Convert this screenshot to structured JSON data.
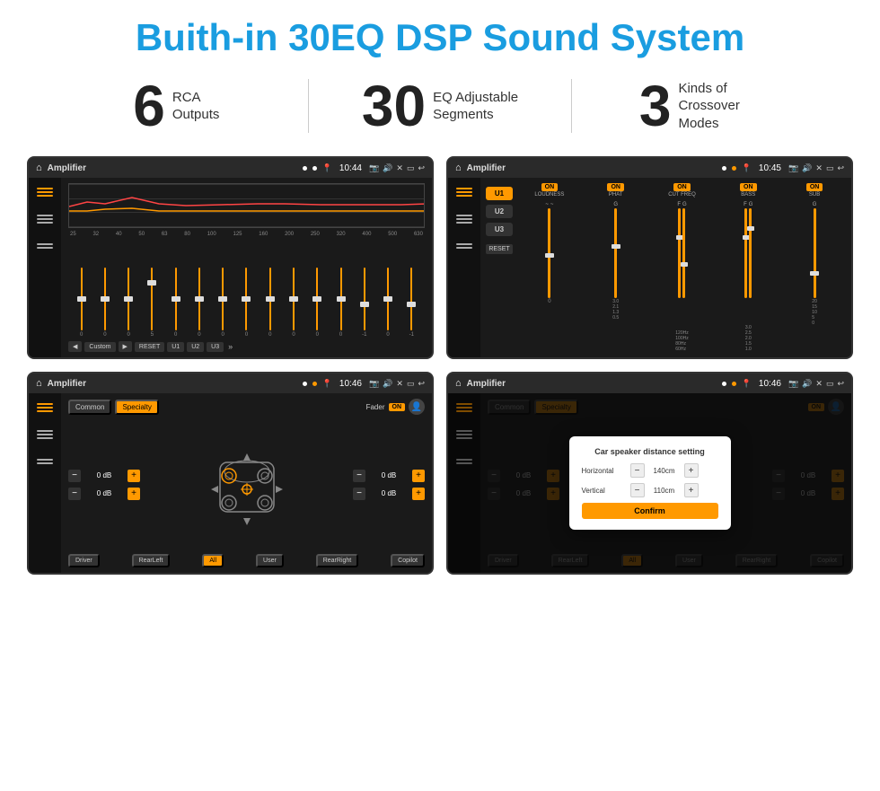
{
  "header": {
    "title": "Buith-in 30EQ DSP Sound System"
  },
  "stats": [
    {
      "number": "6",
      "label": "RCA\nOutputs"
    },
    {
      "number": "30",
      "label": "EQ Adjustable\nSegments"
    },
    {
      "number": "3",
      "label": "Kinds of\nCrossover Modes"
    }
  ],
  "screens": {
    "eq": {
      "title": "Amplifier",
      "time": "10:44",
      "freqs": [
        "25",
        "32",
        "40",
        "50",
        "63",
        "80",
        "100",
        "125",
        "160",
        "200",
        "250",
        "320",
        "400",
        "500",
        "630"
      ],
      "values": [
        "0",
        "0",
        "0",
        "5",
        "0",
        "0",
        "0",
        "0",
        "0",
        "0",
        "0",
        "0",
        "-1",
        "0",
        "-1"
      ],
      "buttons": [
        "Custom",
        "RESET",
        "U1",
        "U2",
        "U3"
      ]
    },
    "presets": {
      "title": "Amplifier",
      "time": "10:45",
      "presets": [
        "U1",
        "U2",
        "U3"
      ],
      "controls": [
        "LOUDNESS",
        "PHAT",
        "CUT FREQ",
        "BASS",
        "SUB"
      ],
      "toggles": [
        "ON",
        "ON",
        "ON",
        "ON",
        "ON"
      ]
    },
    "fader": {
      "title": "Amplifier",
      "time": "10:46",
      "tabs": [
        "Common",
        "Specialty"
      ],
      "fader_label": "Fader",
      "toggle": "ON",
      "db_values": [
        "0 dB",
        "0 dB",
        "0 dB",
        "0 dB"
      ],
      "bottom_btns": [
        "Driver",
        "RearLeft",
        "All",
        "User",
        "RearRight",
        "Copilot"
      ]
    },
    "distance": {
      "title": "Amplifier",
      "time": "10:46",
      "tabs": [
        "Common",
        "Specialty"
      ],
      "dialog": {
        "title": "Car speaker distance setting",
        "horizontal_label": "Horizontal",
        "horizontal_value": "140cm",
        "vertical_label": "Vertical",
        "vertical_value": "110cm",
        "confirm_label": "Confirm"
      },
      "bottom_btns": [
        "Driver",
        "RearLeft",
        "All",
        "User",
        "RearRight",
        "Copilot"
      ],
      "db_values": [
        "0 dB",
        "0 dB"
      ]
    }
  }
}
